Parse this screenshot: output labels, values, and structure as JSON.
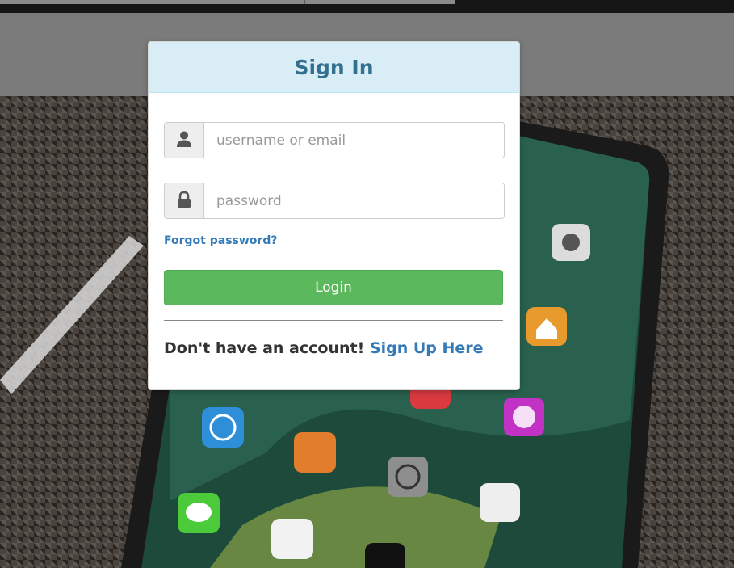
{
  "modal": {
    "title": "Sign In",
    "username_placeholder": "username or email",
    "password_placeholder": "password",
    "forgot_label": "Forgot password?",
    "login_label": "Login",
    "no_account_text": "Don't have an account! ",
    "signup_label": "Sign Up Here"
  },
  "icons": {
    "username": "user-icon",
    "password": "lock-icon"
  },
  "colors": {
    "header_bg": "#d9edf7",
    "title": "#31708f",
    "link": "#337ab7",
    "login_button": "#5cb85c"
  }
}
